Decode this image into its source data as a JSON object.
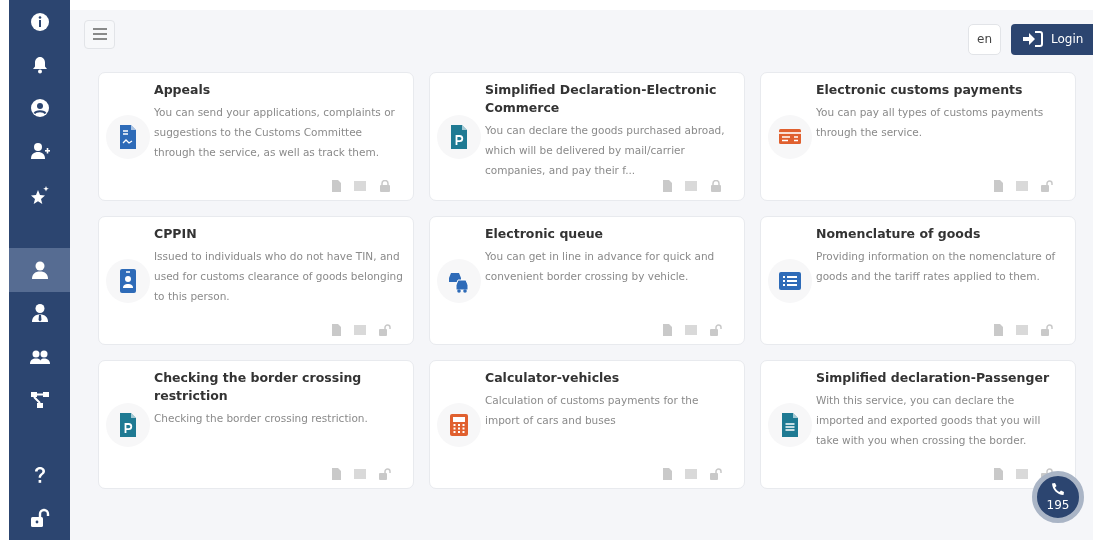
{
  "sidebar": {
    "items": [
      {
        "selected": false
      },
      {
        "selected": false
      },
      {
        "selected": false
      },
      {
        "selected": false
      },
      {
        "selected": false
      },
      {
        "selected": true
      },
      {
        "selected": false
      },
      {
        "selected": false
      },
      {
        "selected": false
      },
      {
        "selected": false
      },
      {
        "selected": false
      }
    ]
  },
  "header": {
    "language": "en",
    "login": "Login"
  },
  "services": [
    {
      "title": "Appeals",
      "description": "You can send your applications, complaints or suggestions to the Customs Committee through the service, as well as track them.",
      "locked": true
    },
    {
      "title": "Simplified Declaration-Electronic Commerce",
      "description": "You can declare the goods purchased abroad, which will be delivered by mail/carrier companies, and pay their f...",
      "locked": true
    },
    {
      "title": "Electronic customs payments",
      "description": "You can pay all types of customs payments through the service.",
      "locked": false
    },
    {
      "title": "CPPIN",
      "description": "Issued to individuals who do not have TIN, and used for customs clearance of goods belonging to this person.",
      "locked": false
    },
    {
      "title": "Electronic queue",
      "description": "You can get in line in advance for quick and convenient border crossing by vehicle.",
      "locked": false
    },
    {
      "title": "Nomenclature of goods",
      "description": "Providing information on the nomenclature of goods and the tariff rates applied to them.",
      "locked": false
    },
    {
      "title": "Checking the border crossing restriction",
      "description": "Checking the border crossing restriction.",
      "locked": false
    },
    {
      "title": "Calculator-vehicles",
      "description": "Calculation of customs payments for the import of cars and buses",
      "locked": false
    },
    {
      "title": "Simplified declaration-Passenger",
      "description": "With this service, you can declare the imported and exported goods that you will take with you when crossing the border.",
      "locked": false
    }
  ],
  "hotline": {
    "number": "195"
  }
}
